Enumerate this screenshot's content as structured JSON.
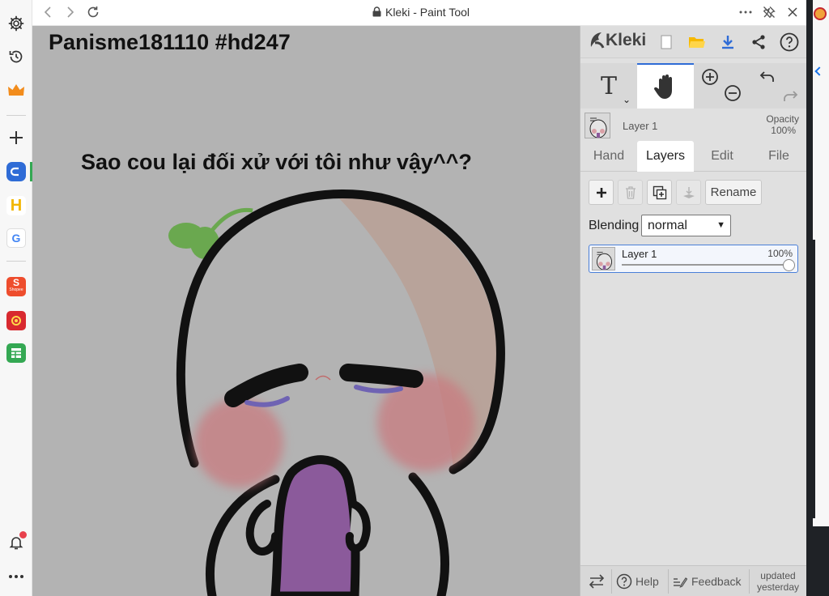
{
  "window": {
    "title": "Kleki - Paint Tool"
  },
  "sidebar": {
    "items": [
      {
        "name": "settings",
        "icon": "gear-icon"
      },
      {
        "name": "history",
        "icon": "history-icon"
      },
      {
        "name": "premium",
        "icon": "crown-icon",
        "color": "#f28c1c"
      },
      {
        "name": "add",
        "icon": "plus-icon"
      },
      {
        "name": "app-1",
        "icon": "app-blue-icon",
        "color": "#2f6cd6"
      },
      {
        "name": "app-2",
        "icon": "app-h-icon",
        "color": "#f2b600"
      },
      {
        "name": "google",
        "icon": "google-icon"
      },
      {
        "name": "shopee",
        "icon": "shopee-icon",
        "label": "Shopee",
        "color": "#ee4d2d"
      },
      {
        "name": "app-red",
        "icon": "app-red-icon",
        "color": "#d8292f"
      },
      {
        "name": "sheets",
        "icon": "sheets-icon",
        "color": "#34a853"
      },
      {
        "name": "notifications",
        "icon": "bell-icon"
      },
      {
        "name": "more",
        "icon": "more-icon"
      }
    ]
  },
  "canvas": {
    "title_text": "Panisme181110 #hd247",
    "caption_text": "Sao cou lại đối xử với tôi như vậy^^?",
    "background": "#b3b3b3"
  },
  "panel": {
    "logo_text": "Kleki",
    "layer_preview": {
      "name": "Layer 1",
      "opacity_label": "Opacity",
      "opacity_value": "100%"
    },
    "tabs": [
      {
        "label": "Hand",
        "active": false
      },
      {
        "label": "Layers",
        "active": true
      },
      {
        "label": "Edit",
        "active": false
      },
      {
        "label": "File",
        "active": false
      }
    ],
    "rename_label": "Rename",
    "blending_label": "Blending",
    "blending_value": "normal",
    "layers": [
      {
        "name": "Layer 1",
        "opacity": "100%",
        "opacity_fraction": 1.0
      }
    ],
    "bottom": {
      "help_label": "Help",
      "feedback_label": "Feedback",
      "updated_line1": "updated",
      "updated_line2": "yesterday"
    },
    "accent_color": "#2f6cd6"
  }
}
